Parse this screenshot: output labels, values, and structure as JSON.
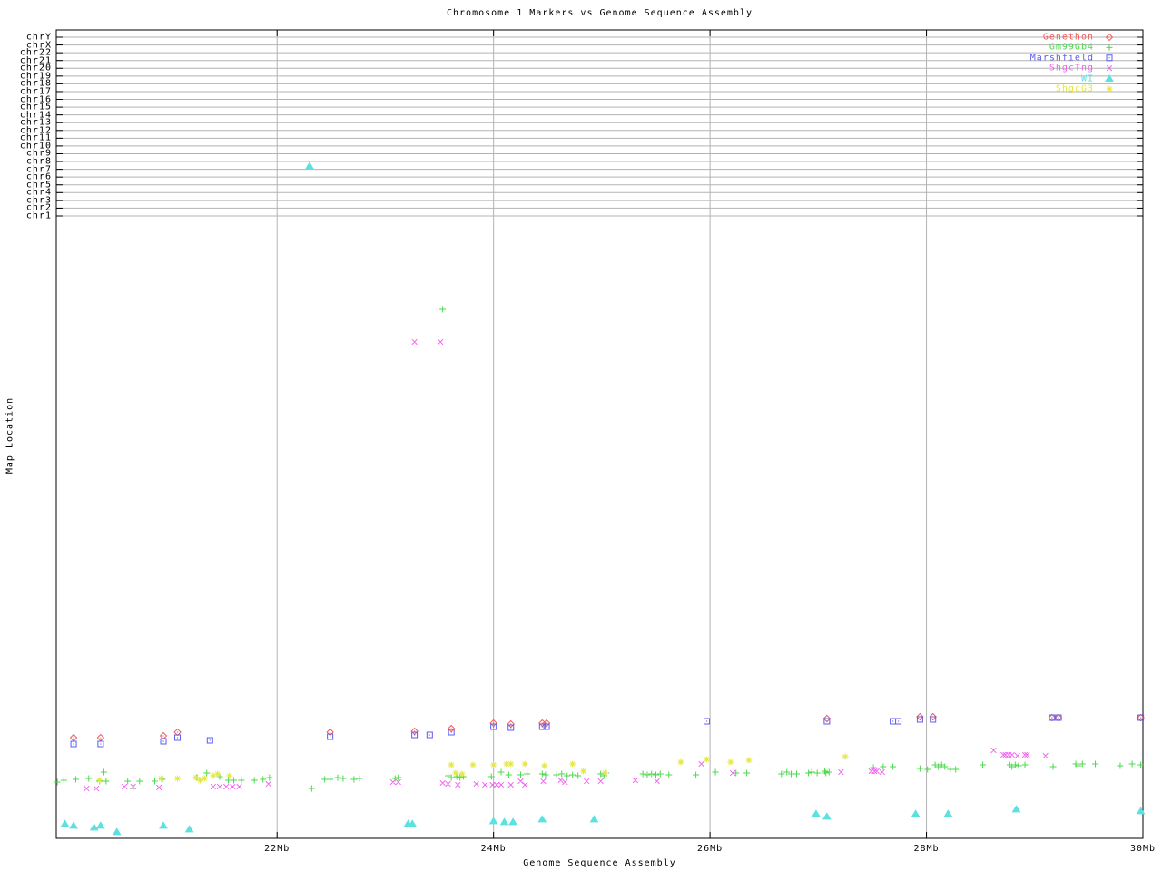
{
  "chart_data": {
    "type": "scatter",
    "title": "Chromosome 1 Markers vs Genome Sequence Assembly",
    "xlabel": "Genome Sequence Assembly",
    "ylabel": "Map Location",
    "x_axis": {
      "tick_labels": [
        "22Mb",
        "24Mb",
        "26Mb",
        "28Mb",
        "30Mb"
      ],
      "tick_values_mb": [
        22,
        24,
        26,
        28,
        30
      ],
      "range_mb": [
        19.96,
        30.0
      ],
      "grid": true
    },
    "y_axis": {
      "kind": "categorical chromosome bands, no numeric scale (point y stored as screen px)",
      "tick_labels": [
        "chrY",
        "chrX",
        "chr22",
        "chr21",
        "chr20",
        "chr19",
        "chr18",
        "chr17",
        "chr16",
        "chr15",
        "chr14",
        "chr13",
        "chr12",
        "chr11",
        "chr10",
        "chr9",
        "chr8",
        "chr7",
        "chr6",
        "chr5",
        "chr4",
        "chr3",
        "chr2",
        "chr1"
      ],
      "grid": true
    },
    "legend": {
      "position": "top-right-inside",
      "entries": [
        {
          "label": "Genethon",
          "marker": "diamond",
          "color": "#f25c5c"
        },
        {
          "label": "Gm99Gb4",
          "marker": "plus",
          "color": "#4cd94c"
        },
        {
          "label": "Marshfield",
          "marker": "boxdot",
          "color": "#5c5cf2"
        },
        {
          "label": "ShgcTng",
          "marker": "cross",
          "color": "#f25cf2"
        },
        {
          "label": "WI",
          "marker": "triangle",
          "color": "#5ce0e0"
        },
        {
          "label": "ShgcG3",
          "marker": "star",
          "color": "#e6e642"
        }
      ]
    },
    "series": [
      {
        "name": "Genethon",
        "marker": "diamond",
        "color": "#f25c5c",
        "points": [
          [
            20.12,
            813
          ],
          [
            20.37,
            813
          ],
          [
            20.95,
            811
          ],
          [
            21.08,
            807
          ],
          [
            22.49,
            807
          ],
          [
            23.27,
            806
          ],
          [
            23.61,
            803
          ],
          [
            24.0,
            797
          ],
          [
            24.16,
            798
          ],
          [
            24.45,
            797
          ],
          [
            24.49,
            797
          ],
          [
            27.08,
            792
          ],
          [
            27.94,
            790
          ],
          [
            28.06,
            790
          ],
          [
            29.16,
            791
          ],
          [
            29.22,
            791
          ],
          [
            29.98,
            791
          ]
        ]
      },
      {
        "name": "Marshfield",
        "marker": "boxdot",
        "color": "#5c5cf2",
        "points": [
          [
            20.12,
            820
          ],
          [
            20.37,
            820
          ],
          [
            20.95,
            817
          ],
          [
            21.08,
            813
          ],
          [
            21.38,
            816
          ],
          [
            22.49,
            812
          ],
          [
            23.27,
            810
          ],
          [
            23.41,
            810
          ],
          [
            23.61,
            807
          ],
          [
            24.0,
            801
          ],
          [
            24.16,
            802
          ],
          [
            24.45,
            801
          ],
          [
            24.49,
            801
          ],
          [
            25.97,
            795
          ],
          [
            27.08,
            795
          ],
          [
            27.69,
            795
          ],
          [
            27.74,
            795
          ],
          [
            27.94,
            793
          ],
          [
            28.06,
            793
          ],
          [
            29.16,
            791
          ],
          [
            29.22,
            791
          ],
          [
            29.98,
            791
          ]
        ]
      },
      {
        "name": "Gm99Gb4",
        "marker": "plus",
        "color": "#4cd94c",
        "points": [
          [
            19.97,
            862
          ],
          [
            20.03,
            860
          ],
          [
            20.14,
            859
          ],
          [
            20.26,
            858
          ],
          [
            20.36,
            861
          ],
          [
            20.4,
            851
          ],
          [
            20.42,
            861
          ],
          [
            20.62,
            861
          ],
          [
            20.67,
            869
          ],
          [
            20.73,
            861
          ],
          [
            20.87,
            861
          ],
          [
            20.94,
            859
          ],
          [
            21.26,
            857
          ],
          [
            21.35,
            852
          ],
          [
            21.47,
            856
          ],
          [
            21.55,
            860
          ],
          [
            21.6,
            860
          ],
          [
            21.67,
            860
          ],
          [
            21.79,
            860
          ],
          [
            21.87,
            859
          ],
          [
            21.93,
            857
          ],
          [
            22.32,
            869
          ],
          [
            22.44,
            859
          ],
          [
            22.49,
            859
          ],
          [
            22.56,
            857
          ],
          [
            22.61,
            858
          ],
          [
            22.71,
            859
          ],
          [
            22.76,
            858
          ],
          [
            23.09,
            858
          ],
          [
            23.12,
            857
          ],
          [
            23.53,
            341
          ],
          [
            23.58,
            855
          ],
          [
            23.61,
            857
          ],
          [
            23.66,
            856
          ],
          [
            23.69,
            857
          ],
          [
            23.72,
            856
          ],
          [
            23.98,
            856
          ],
          [
            24.07,
            851
          ],
          [
            24.14,
            854
          ],
          [
            24.25,
            854
          ],
          [
            24.31,
            853
          ],
          [
            24.45,
            853
          ],
          [
            24.48,
            854
          ],
          [
            24.58,
            854
          ],
          [
            24.63,
            853
          ],
          [
            24.68,
            855
          ],
          [
            24.73,
            854
          ],
          [
            24.78,
            855
          ],
          [
            24.99,
            853
          ],
          [
            25.02,
            855
          ],
          [
            25.04,
            852
          ],
          [
            25.38,
            853
          ],
          [
            25.42,
            854
          ],
          [
            25.46,
            853
          ],
          [
            25.5,
            854
          ],
          [
            25.54,
            853
          ],
          [
            25.62,
            854
          ],
          [
            25.87,
            854
          ],
          [
            26.05,
            851
          ],
          [
            26.24,
            852
          ],
          [
            26.34,
            852
          ],
          [
            26.66,
            853
          ],
          [
            26.71,
            851
          ],
          [
            26.75,
            853
          ],
          [
            26.8,
            853
          ],
          [
            26.91,
            852
          ],
          [
            26.94,
            851
          ],
          [
            26.99,
            852
          ],
          [
            27.06,
            850
          ],
          [
            27.07,
            852
          ],
          [
            27.1,
            851
          ],
          [
            27.51,
            846
          ],
          [
            27.6,
            845
          ],
          [
            27.69,
            845
          ],
          [
            27.94,
            847
          ],
          [
            28.01,
            848
          ],
          [
            28.08,
            843
          ],
          [
            28.11,
            845
          ],
          [
            28.14,
            843
          ],
          [
            28.17,
            845
          ],
          [
            28.22,
            848
          ],
          [
            28.27,
            848
          ],
          [
            28.52,
            843
          ],
          [
            28.77,
            843
          ],
          [
            28.79,
            845
          ],
          [
            28.82,
            843
          ],
          [
            28.85,
            844
          ],
          [
            28.91,
            843
          ],
          [
            29.17,
            845
          ],
          [
            29.38,
            842
          ],
          [
            29.4,
            844
          ],
          [
            29.44,
            842
          ],
          [
            29.56,
            842
          ],
          [
            29.79,
            844
          ],
          [
            29.9,
            842
          ],
          [
            29.98,
            843
          ]
        ]
      },
      {
        "name": "ShgcTng",
        "marker": "cross",
        "color": "#f25cf2",
        "points": [
          [
            20.24,
            869
          ],
          [
            20.33,
            869
          ],
          [
            20.59,
            867
          ],
          [
            20.67,
            867
          ],
          [
            20.91,
            868
          ],
          [
            21.41,
            867
          ],
          [
            21.47,
            867
          ],
          [
            21.53,
            867
          ],
          [
            21.59,
            867
          ],
          [
            21.65,
            867
          ],
          [
            21.92,
            864
          ],
          [
            23.07,
            862
          ],
          [
            23.12,
            862
          ],
          [
            23.27,
            377
          ],
          [
            23.51,
            377
          ],
          [
            23.53,
            863
          ],
          [
            23.58,
            864
          ],
          [
            23.67,
            865
          ],
          [
            23.84,
            864
          ],
          [
            23.92,
            865
          ],
          [
            23.99,
            865
          ],
          [
            24.03,
            865
          ],
          [
            24.07,
            865
          ],
          [
            24.16,
            865
          ],
          [
            24.25,
            861
          ],
          [
            24.29,
            865
          ],
          [
            24.46,
            861
          ],
          [
            24.62,
            860
          ],
          [
            24.66,
            862
          ],
          [
            24.86,
            861
          ],
          [
            24.99,
            861
          ],
          [
            25.31,
            860
          ],
          [
            25.51,
            861
          ],
          [
            25.92,
            842
          ],
          [
            26.21,
            852
          ],
          [
            27.21,
            851
          ],
          [
            27.49,
            850
          ],
          [
            27.52,
            850
          ],
          [
            27.54,
            850
          ],
          [
            27.59,
            851
          ],
          [
            28.62,
            827
          ],
          [
            28.71,
            832
          ],
          [
            28.73,
            832
          ],
          [
            28.76,
            832
          ],
          [
            28.79,
            832
          ],
          [
            28.84,
            833
          ],
          [
            28.91,
            832
          ],
          [
            28.93,
            832
          ],
          [
            29.1,
            833
          ]
        ]
      },
      {
        "name": "WI",
        "marker": "triangle",
        "color": "#5ce0e0",
        "points": [
          [
            20.04,
            908
          ],
          [
            20.12,
            910
          ],
          [
            20.31,
            912
          ],
          [
            20.37,
            910
          ],
          [
            20.52,
            917
          ],
          [
            20.95,
            910
          ],
          [
            21.19,
            914
          ],
          [
            22.3,
            183
          ],
          [
            23.21,
            908
          ],
          [
            23.25,
            908
          ],
          [
            24.0,
            905
          ],
          [
            24.1,
            906
          ],
          [
            24.18,
            906
          ],
          [
            24.45,
            903
          ],
          [
            24.93,
            903
          ],
          [
            26.98,
            897
          ],
          [
            27.08,
            900
          ],
          [
            27.9,
            897
          ],
          [
            28.2,
            897
          ],
          [
            28.83,
            892
          ],
          [
            29.98,
            894
          ]
        ]
      },
      {
        "name": "ShgcG3",
        "marker": "star",
        "color": "#e6e642",
        "points": [
          [
            20.36,
            860
          ],
          [
            20.93,
            858
          ],
          [
            21.08,
            858
          ],
          [
            21.25,
            857
          ],
          [
            21.29,
            860
          ],
          [
            21.33,
            858
          ],
          [
            21.41,
            855
          ],
          [
            21.45,
            853
          ],
          [
            21.56,
            855
          ],
          [
            23.61,
            843
          ],
          [
            23.65,
            852
          ],
          [
            23.71,
            853
          ],
          [
            23.81,
            843
          ],
          [
            24.0,
            843
          ],
          [
            24.12,
            842
          ],
          [
            24.16,
            842
          ],
          [
            24.29,
            842
          ],
          [
            24.47,
            844
          ],
          [
            24.73,
            842
          ],
          [
            24.83,
            850
          ],
          [
            25.03,
            852
          ],
          [
            25.73,
            840
          ],
          [
            25.97,
            837
          ],
          [
            26.19,
            840
          ],
          [
            26.36,
            838
          ],
          [
            27.25,
            834
          ]
        ]
      }
    ]
  }
}
